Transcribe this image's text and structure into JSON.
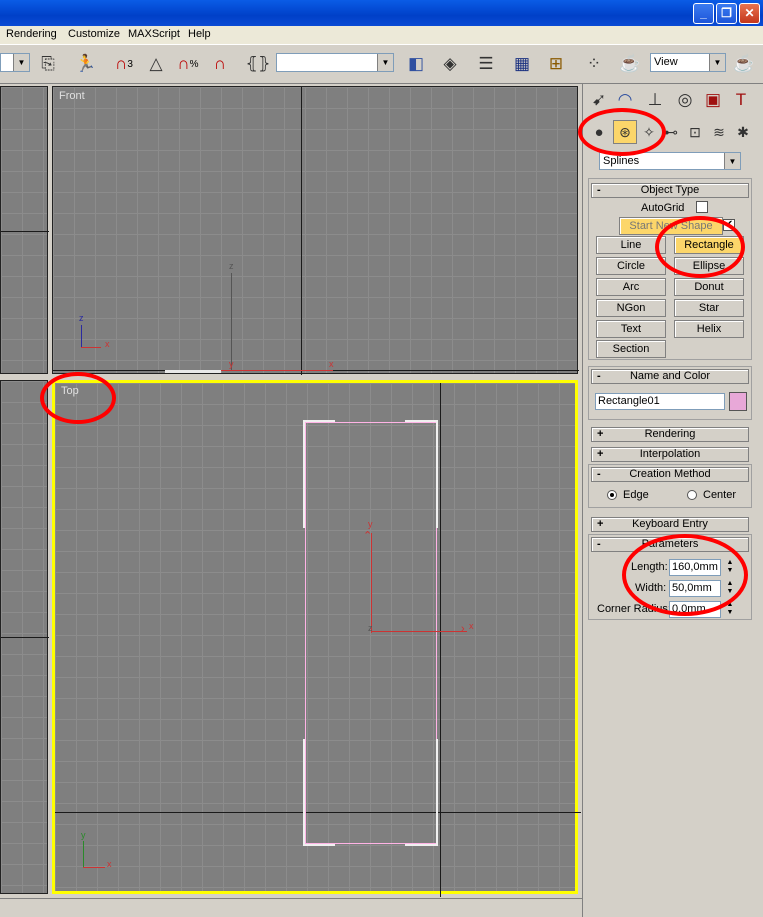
{
  "titlebar": {
    "buttons": [
      "_",
      "❐",
      "✕"
    ]
  },
  "menu": {
    "items": [
      "Rendering",
      "Customize",
      "MAXScript",
      "Help"
    ]
  },
  "toolbar": {
    "snap_label": "3",
    "percent_label": "%",
    "view_combo_value": "View",
    "named_selection_value": ""
  },
  "viewports": {
    "front": {
      "label": "Front",
      "axis_z": "z",
      "axis_x": "x",
      "axis_y": "y",
      "gizmo_z": "z",
      "gizmo_x": "x"
    },
    "top": {
      "label": "Top",
      "gizmo_y": "y",
      "gizmo_x": "x",
      "axis_y": "y",
      "axis_x": "x",
      "axis_z": "z"
    }
  },
  "command_panel": {
    "category_dropdown": "Splines",
    "object_type": {
      "title": "Object Type",
      "autogrid_label": "AutoGrid",
      "start_new_shape": "Start New Shape",
      "buttons": [
        "Line",
        "Rectangle",
        "Circle",
        "Ellipse",
        "Arc",
        "Donut",
        "NGon",
        "Star",
        "Text",
        "Helix",
        "Section"
      ],
      "active": "Rectangle"
    },
    "name_and_color": {
      "title": "Name and Color",
      "name_value": "Rectangle01",
      "color": "#e8a8d8"
    },
    "rollouts": {
      "rendering": "Rendering",
      "interpolation": "Interpolation",
      "creation_method": "Creation Method",
      "keyboard_entry": "Keyboard Entry",
      "parameters": "Parameters"
    },
    "creation_method": {
      "edge": "Edge",
      "center": "Center",
      "selected": "Edge"
    },
    "parameters": {
      "length_label": "Length:",
      "length_value": "160,0mm",
      "width_label": "Width:",
      "width_value": "50,0mm",
      "corner_label": "Corner Radius:",
      "corner_value": "0,0mm"
    }
  },
  "colors": {
    "active_viewport_border": "#ffff00",
    "annotation": "#ff0000",
    "highlight_button": "#fcd66a",
    "shape_outline": "#ffb3e6"
  }
}
